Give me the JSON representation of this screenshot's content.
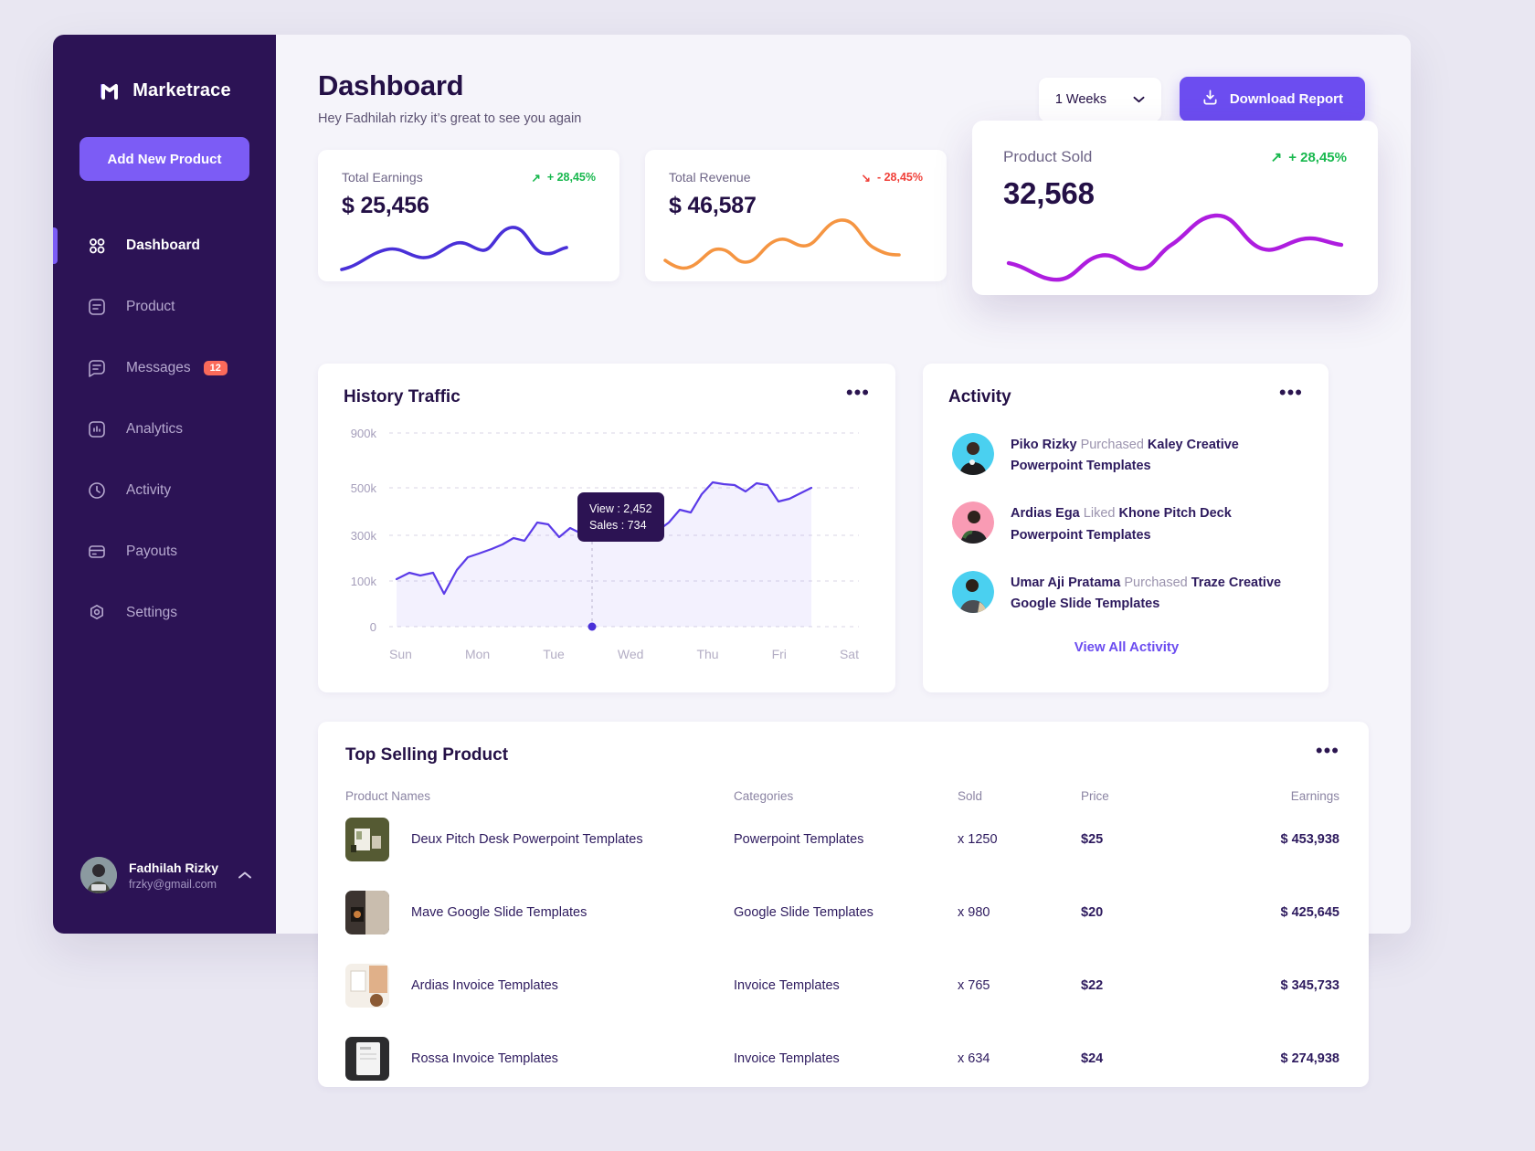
{
  "brand": {
    "name": "Marketrace",
    "logo_icon": "m-logo-icon"
  },
  "sidebar": {
    "add_product_label": "Add New Product",
    "items": [
      {
        "label": "Dashboard",
        "icon": "grid-icon",
        "active": true
      },
      {
        "label": "Product",
        "icon": "document-icon",
        "active": false
      },
      {
        "label": "Messages",
        "icon": "message-icon",
        "active": false,
        "badge": "12"
      },
      {
        "label": "Analytics",
        "icon": "chart-bar-icon",
        "active": false
      },
      {
        "label": "Activity",
        "icon": "clock-icon",
        "active": false
      },
      {
        "label": "Payouts",
        "icon": "card-icon",
        "active": false
      },
      {
        "label": "Settings",
        "icon": "gear-icon",
        "active": false
      }
    ],
    "profile": {
      "name": "Fadhilah Rizky",
      "email": "frzky@gmail.com",
      "chevron": "^"
    }
  },
  "header": {
    "title": "Dashboard",
    "subtitle": "Hey Fadhilah rizky it’s great to see you again",
    "range_value": "1 Weeks",
    "range_chevron": "▾",
    "download_label": "Download Report",
    "download_icon": "download-icon"
  },
  "stats": [
    {
      "label": "Total Earnings",
      "value": "$ 25,456",
      "delta": "+ 28,45%",
      "direction": "up",
      "arrow": "↗",
      "color": "#4930d8"
    },
    {
      "label": "Total Revenue",
      "value": "$ 46,587",
      "delta": "- 28,45%",
      "direction": "down",
      "arrow": "↘",
      "color": "#f59542"
    },
    {
      "label": "Product Sold",
      "value": "32,568",
      "delta": "+ 28,45%",
      "direction": "up",
      "arrow": "↗",
      "color": "#ae1ddf"
    }
  ],
  "traffic": {
    "title": "History Traffic",
    "menu_icon": "more-icon",
    "tooltip": {
      "view": "View : 2,452",
      "sales": "Sales : 734"
    }
  },
  "activity": {
    "title": "Activity",
    "menu_icon": "more-icon",
    "view_all_label": "View All Activity",
    "items": [
      {
        "name": "Piko Rizky",
        "action": "Purchased",
        "product": "Kaley Creative Powerpoint Templates",
        "avatar_color": "#4ad0f0"
      },
      {
        "name": "Ardias Ega",
        "action": "Liked",
        "product": "Khone Pitch Deck Powerpoint Templates",
        "avatar_color": "#f99bb4"
      },
      {
        "name": "Umar Aji Pratama",
        "action": "Purchased",
        "product": "Traze Creative Google Slide Templates",
        "avatar_color": "#4ad0f0"
      }
    ]
  },
  "top_selling": {
    "title": "Top Selling Product",
    "menu_icon": "more-icon",
    "columns": [
      "Product Names",
      "Categories",
      "Sold",
      "Price",
      "Earnings"
    ],
    "rows": [
      {
        "product": "Deux Pitch Desk Powerpoint Templates",
        "category": "Powerpoint Templates",
        "sold": "x 1250",
        "price": "$25",
        "earnings": "$ 453,938",
        "thumb_color": "#555a33"
      },
      {
        "product": "Mave Google Slide Templates",
        "category": "Google Slide Templates",
        "sold": "x 980",
        "price": "$20",
        "earnings": "$ 425,645",
        "thumb_color": "#3c3430"
      },
      {
        "product": "Ardias Invoice Templates",
        "category": "Invoice Templates",
        "sold": "x 765",
        "price": "$22",
        "earnings": "$ 345,733",
        "thumb_color": "#efe6dd"
      },
      {
        "product": "Rossa Invoice Templates",
        "category": "Invoice Templates",
        "sold": "x 634",
        "price": "$24",
        "earnings": "$ 274,938",
        "thumb_color": "#2c2c2e"
      }
    ]
  },
  "chart_data": {
    "type": "line",
    "title": "History Traffic",
    "xlabel": "",
    "ylabel": "",
    "categories": [
      "Sun",
      "Mon",
      "Tue",
      "Wed",
      "Thu",
      "Fri",
      "Sat"
    ],
    "ytick_labels": [
      "0",
      "100k",
      "300k",
      "500k",
      "900k"
    ],
    "ytick_values": [
      0,
      100000,
      300000,
      500000,
      900000
    ],
    "grid": true,
    "legend": "none",
    "highlight": {
      "x": "Wed",
      "view": 2452,
      "sales": 734
    },
    "values": [
      105000,
      120000,
      112000,
      118000,
      80000,
      150000,
      190000,
      200000,
      215000,
      230000,
      255000,
      250000,
      310000,
      305000,
      270000,
      300000,
      285000,
      300000,
      275000,
      272000,
      300000,
      290000,
      295000,
      292000,
      320000,
      360000,
      350000,
      420000,
      480000,
      470000,
      465000,
      440000,
      480000,
      470000,
      410000,
      420000,
      440000,
      460000
    ]
  }
}
